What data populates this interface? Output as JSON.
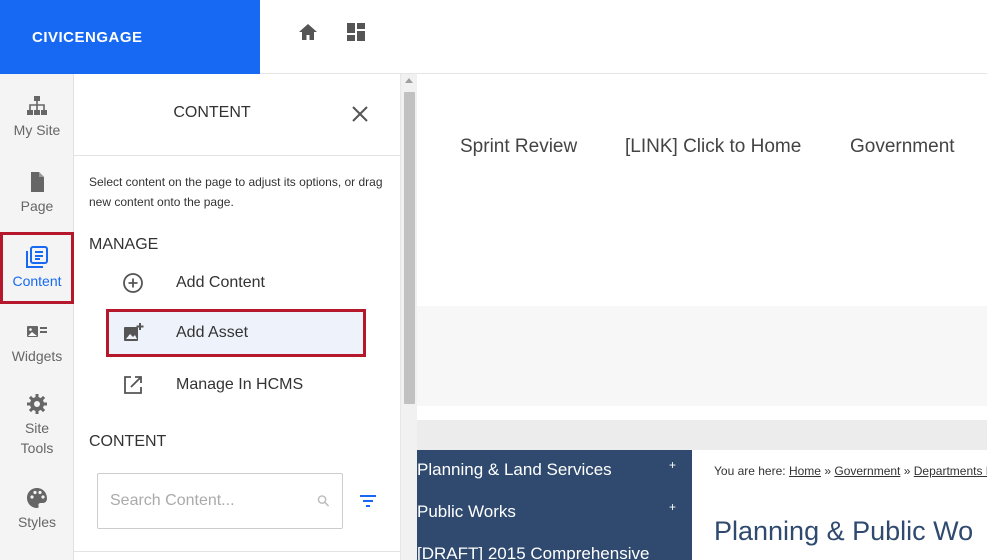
{
  "brand": {
    "name": "CIVICENGAGE"
  },
  "topbar": {
    "icons": [
      "home-icon",
      "dashboard-icon"
    ]
  },
  "rail": {
    "items": [
      {
        "label": "My Site",
        "icon": "sitemap-icon"
      },
      {
        "label": "Page",
        "icon": "page-icon"
      },
      {
        "label": "Content",
        "icon": "content-icon",
        "active": true
      },
      {
        "label": "Widgets",
        "icon": "widgets-icon"
      },
      {
        "label": "Site Tools",
        "icon": "gear-icon"
      },
      {
        "label": "Styles",
        "icon": "palette-icon"
      }
    ]
  },
  "panel": {
    "title": "CONTENT",
    "help": "Select content on the page to adjust its options, or drag new content onto the page.",
    "manage_heading": "MANAGE",
    "manage_items": [
      {
        "label": "Add Content",
        "icon": "add-circle-icon"
      },
      {
        "label": "Add Asset",
        "icon": "add-image-icon",
        "highlighted": true
      },
      {
        "label": "Manage In HCMS",
        "icon": "external-link-icon"
      }
    ],
    "content_heading": "CONTENT",
    "search_placeholder": "Search Content..."
  },
  "site": {
    "nav": [
      "Sprint Review",
      "[LINK] Click to Home",
      "Government"
    ],
    "sidenav": [
      {
        "label": "Planning & Land Services",
        "toggle": "+"
      },
      {
        "label": "Public Works",
        "toggle": "+"
      },
      {
        "label": "[DRAFT] 2015 Comprehensive",
        "toggle": ""
      }
    ],
    "breadcrumb": {
      "prefix": "You are here:",
      "links": [
        "Home",
        "Government",
        "Departments H"
      ],
      "separator": "»"
    },
    "page_heading": "Planning & Public Wo"
  },
  "colors": {
    "brand": "#1769f4",
    "highlight_border": "#b5172b",
    "sidenav_bg": "#2f4a6e"
  }
}
